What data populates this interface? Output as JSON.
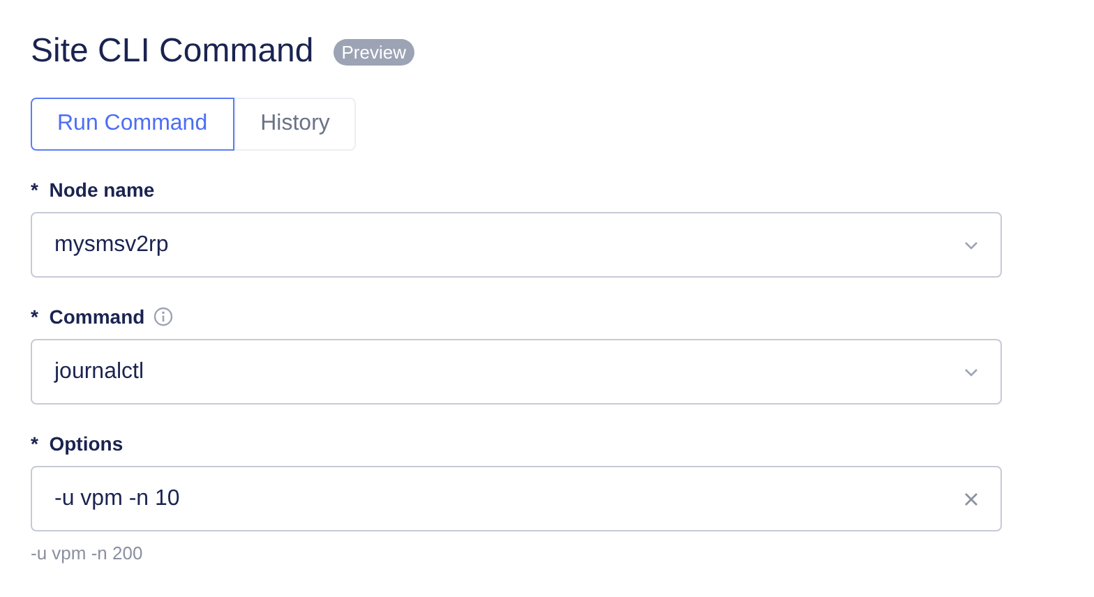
{
  "title": "Site CLI Command",
  "badge": "Preview",
  "tabs": [
    {
      "label": "Run Command",
      "selected": true
    },
    {
      "label": "History",
      "selected": false
    }
  ],
  "fields": [
    {
      "marker": "*",
      "label": "Node name",
      "kind": "select",
      "value": "mysmsv2rp",
      "info": false
    },
    {
      "marker": "*",
      "label": "Command",
      "kind": "select",
      "value": "journalctl",
      "info": true
    },
    {
      "marker": "*",
      "label": "Options",
      "kind": "text",
      "value": "-u vpm -n 10",
      "info": false,
      "hint": "-u vpm -n 200"
    }
  ]
}
